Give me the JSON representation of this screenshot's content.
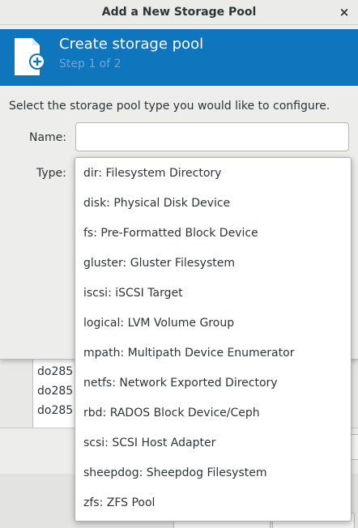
{
  "dialog": {
    "title": "Add a New Storage Pool",
    "close_label": "×",
    "header_title": "Create storage pool",
    "header_step": "Step 1 of 2",
    "accent_color": "#0f75bd",
    "instruction": "Select the storage pool type you would like to configure.",
    "name_label": "Name:",
    "name_value": "",
    "type_label": "Type:"
  },
  "dropdown": {
    "options": [
      "dir: Filesystem Directory",
      "disk: Physical Disk Device",
      "fs: Pre-Formatted Block Device",
      "gluster: Gluster Filesystem",
      "iscsi: iSCSI Target",
      "logical: LVM Volume Group",
      "mpath: Multipath Device Enumerator",
      "netfs: Network Exported Directory",
      "rbd: RADOS Block Device/Ceph",
      "scsi: SCSI Host Adapter",
      "sheepdog: Sheepdog Filesystem",
      "zfs: ZFS Pool"
    ]
  },
  "background": {
    "list_items": [
      "do285",
      "do285",
      "do285"
    ]
  },
  "icons": {
    "header": "new-document-icon",
    "close": "close-icon"
  }
}
